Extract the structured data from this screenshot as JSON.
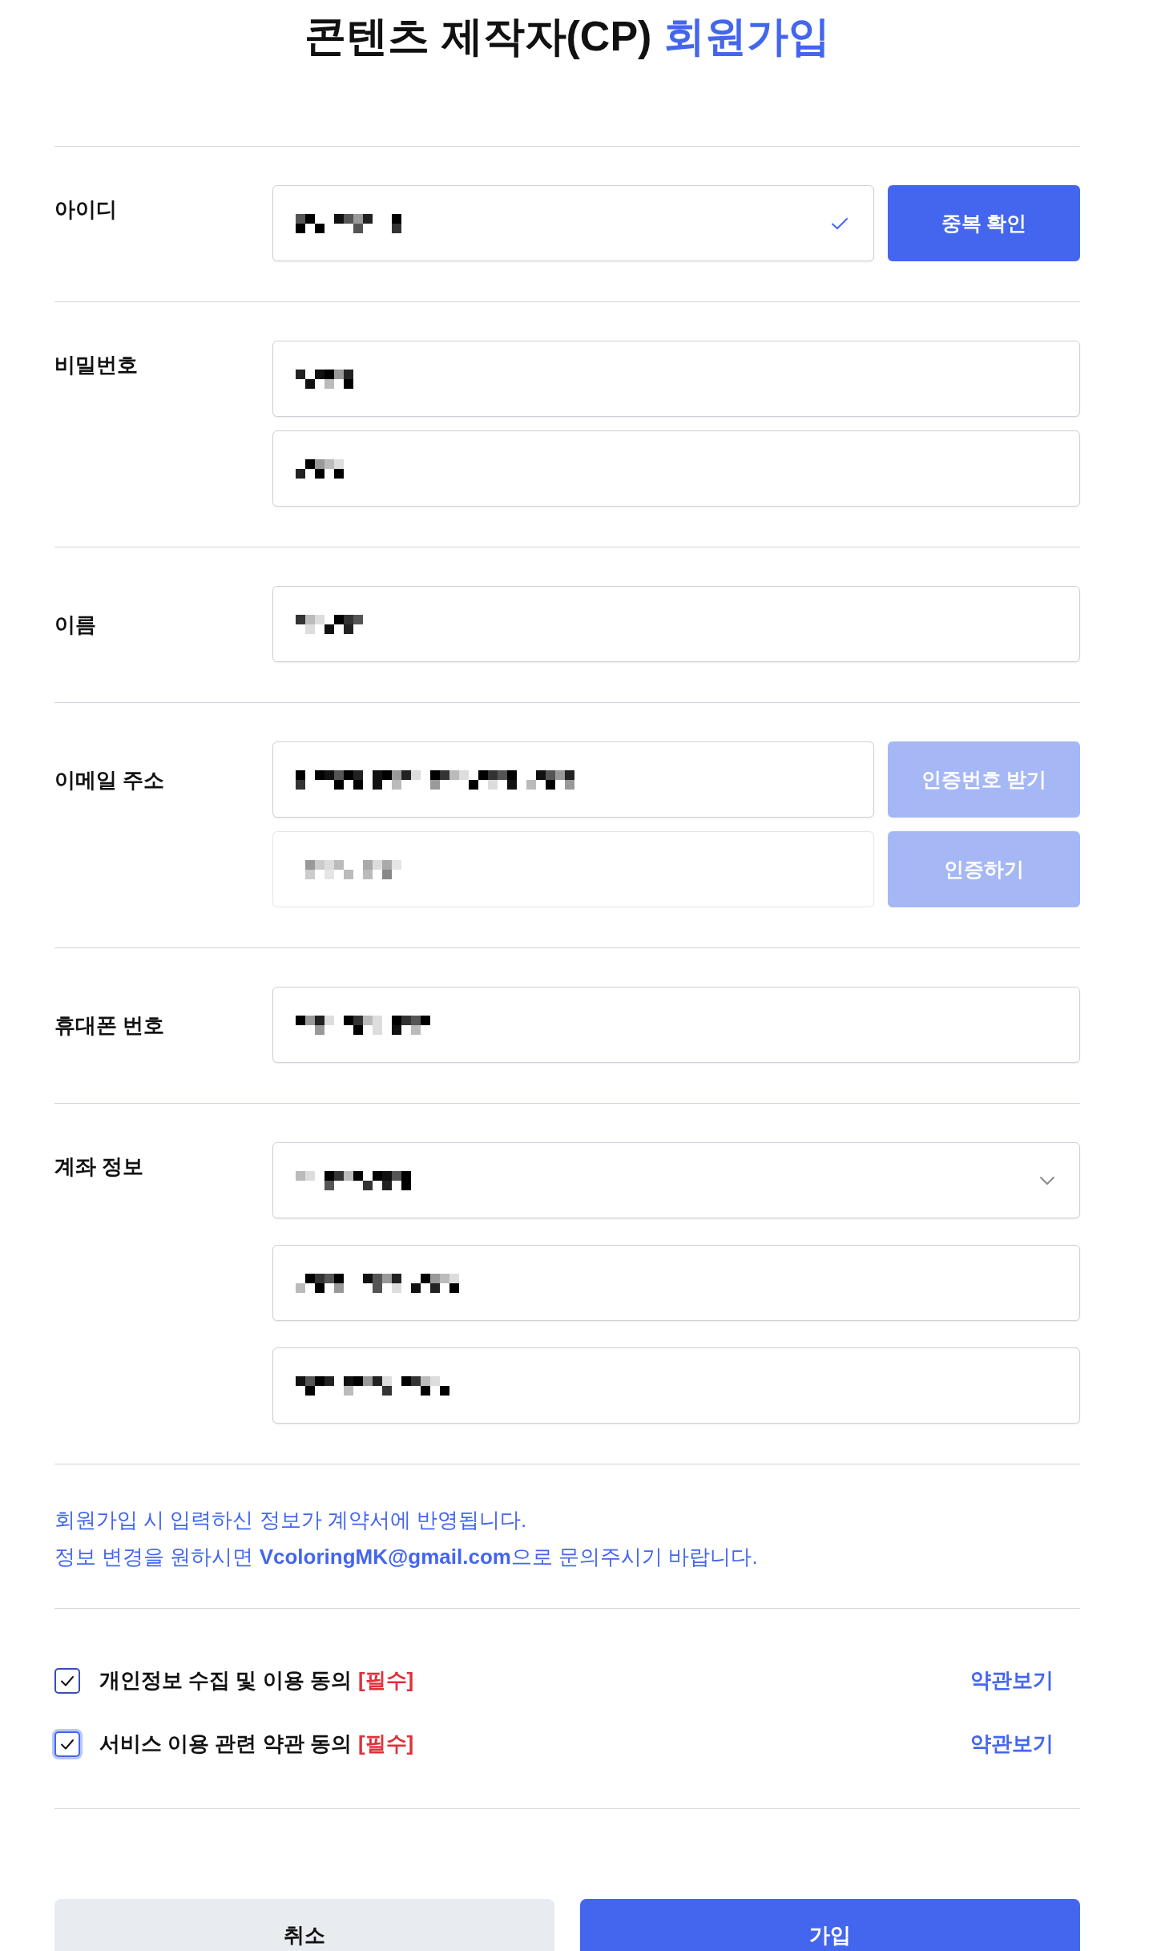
{
  "title": {
    "text": "콘텐츠 제작자(CP)",
    "accent": "회원가입"
  },
  "rows": [
    {
      "label": "아이디",
      "fields": [
        {
          "kind": "text",
          "masked": true,
          "disabled": false,
          "verified": true,
          "button": {
            "label": "중복 확인",
            "disabled": false
          }
        }
      ]
    },
    {
      "label": "비밀번호",
      "fields": [
        {
          "kind": "text",
          "masked": true,
          "disabled": false,
          "verified": false
        },
        {
          "kind": "text",
          "masked": true,
          "disabled": false,
          "verified": false
        }
      ]
    },
    {
      "label": "이름",
      "fields": [
        {
          "kind": "text",
          "masked": true,
          "disabled": false,
          "verified": false
        }
      ]
    },
    {
      "label": "이메일 주소",
      "fields": [
        {
          "kind": "text",
          "masked": true,
          "disabled": false,
          "verified": false,
          "button": {
            "label": "인증번호 받기",
            "disabled": true
          }
        },
        {
          "kind": "text",
          "masked": true,
          "disabled": true,
          "verified": false,
          "button": {
            "label": "인증하기",
            "disabled": true
          }
        }
      ]
    },
    {
      "label": "휴대폰 번호",
      "fields": [
        {
          "kind": "text",
          "masked": true,
          "disabled": false,
          "verified": false
        }
      ]
    },
    {
      "label": "계좌 정보",
      "fields": [
        {
          "kind": "select",
          "masked": true,
          "disabled": false,
          "verified": false
        },
        {
          "kind": "text",
          "masked": true,
          "disabled": false,
          "verified": false
        },
        {
          "kind": "text",
          "masked": true,
          "disabled": false,
          "verified": false
        }
      ]
    }
  ],
  "notice": [
    "회원가입 시 입력하신 정보가 계약서에 반영됩니다.",
    "정보 변경을 원하시면 **VcoloringMK@gmail.com**으로 문의주시기 바랍니다."
  ],
  "agreements": [
    {
      "label": "개인정보 수집 및 이용 동의",
      "tag": "[필수]",
      "checked": true,
      "focused": false,
      "link": "약관보기"
    },
    {
      "label": "서비스 이용 관련 약관 동의",
      "tag": "[필수]",
      "checked": true,
      "focused": true,
      "link": "약관보기"
    }
  ],
  "actions": [
    {
      "label": "취소",
      "kind": "secondary"
    },
    {
      "label": "가입",
      "kind": "primary"
    }
  ]
}
